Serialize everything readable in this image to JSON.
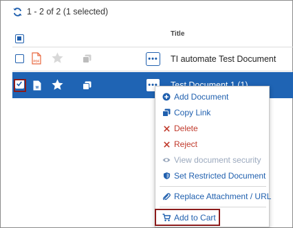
{
  "header": {
    "count_text": "1 - 2 of 2 (1 selected)",
    "refresh_icon": "refresh-icon"
  },
  "columns": {
    "title": "Title"
  },
  "rows": [
    {
      "title": "TI automate Test Document",
      "file_type": "PDF",
      "selected": false,
      "starred": false
    },
    {
      "title": "Test Document 1 (1)",
      "file_type": "W",
      "selected": true,
      "starred": true
    }
  ],
  "row_actions_label": "•••",
  "menu": {
    "items": [
      {
        "label": "Add Document",
        "icon": "plus-circle-icon",
        "color": "#1f5fae"
      },
      {
        "label": "Copy Link",
        "icon": "copy-icon",
        "color": "#1f5fae"
      },
      {
        "label": "Delete",
        "icon": "x-icon",
        "color": "#c0392b"
      },
      {
        "label": "Reject",
        "icon": "x-icon",
        "color": "#c0392b"
      },
      {
        "label": "View document security",
        "icon": "eye-icon",
        "color": "#9aa8bd",
        "disabled": true
      },
      {
        "label": "Set Restricted Document",
        "icon": "shield-icon",
        "color": "#1f5fae"
      },
      {
        "label": "Replace Attachment / URL",
        "icon": "paperclip-icon",
        "color": "#1f5fae"
      },
      {
        "label": "Add to Cart",
        "icon": "cart-icon",
        "color": "#1f5fae"
      }
    ]
  },
  "colors": {
    "accent": "#1f5fae",
    "selected_row": "#1f64b4",
    "danger": "#c0392b",
    "pdf_icon": "#e8663d",
    "highlight_outline": "#8b1a1a"
  }
}
